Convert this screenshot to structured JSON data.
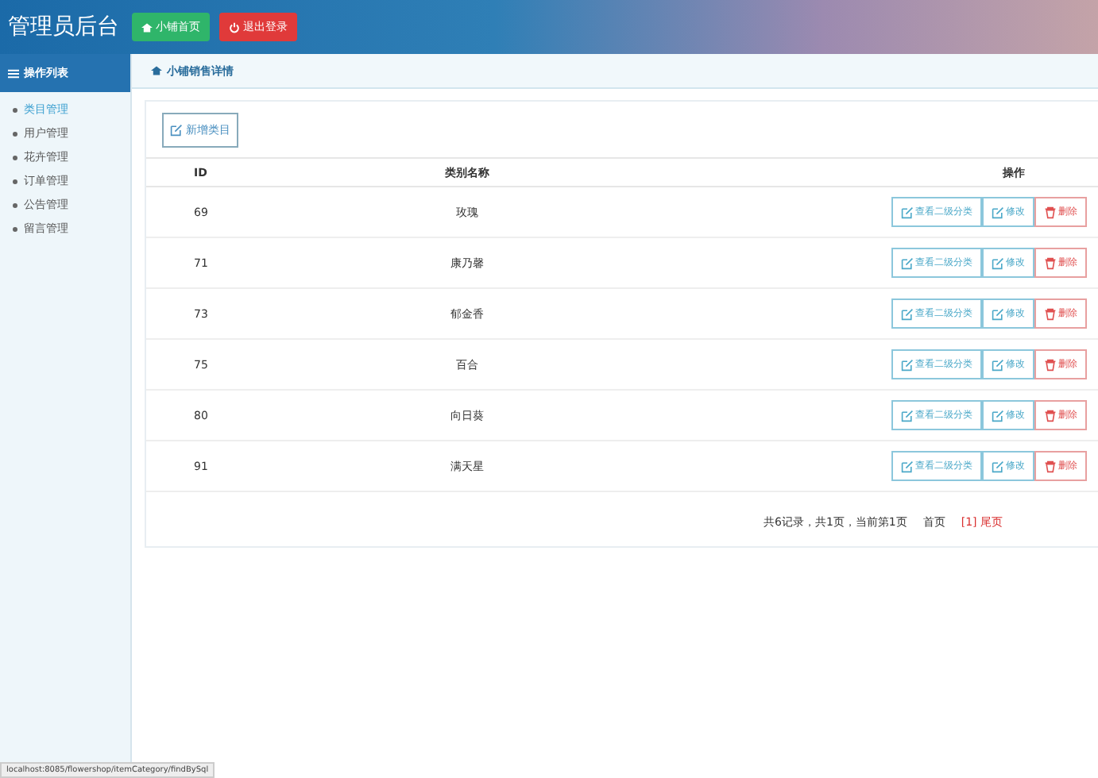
{
  "header": {
    "title": "管理员后台",
    "buttons": [
      {
        "kind": "home",
        "label": "小铺首页"
      },
      {
        "kind": "logout",
        "label": "退出登录"
      }
    ]
  },
  "sidebar": {
    "title": "操作列表",
    "items": [
      {
        "label": "类目管理",
        "selected": true
      },
      {
        "label": "用户管理",
        "selected": false
      },
      {
        "label": "花卉管理",
        "selected": false
      },
      {
        "label": "订单管理",
        "selected": false
      },
      {
        "label": "公告管理",
        "selected": false
      },
      {
        "label": "留言管理",
        "selected": false
      }
    ]
  },
  "breadcrumb": "小铺销售详情",
  "add_button": "新增类目",
  "table": {
    "columns": [
      "ID",
      "类别名称",
      "操作"
    ],
    "rows": [
      {
        "id": "69",
        "name": "玫瑰",
        "actions": [
          {
            "kind": "view",
            "label": "查看二级分类"
          },
          {
            "kind": "edit",
            "label": "修改"
          },
          {
            "kind": "delete",
            "label": "删除"
          }
        ]
      },
      {
        "id": "71",
        "name": "康乃馨",
        "actions": [
          {
            "kind": "view",
            "label": "查看二级分类"
          },
          {
            "kind": "edit",
            "label": "修改"
          },
          {
            "kind": "delete",
            "label": "删除"
          }
        ]
      },
      {
        "id": "73",
        "name": "郁金香",
        "actions": [
          {
            "kind": "view",
            "label": "查看二级分类"
          },
          {
            "kind": "edit",
            "label": "修改"
          },
          {
            "kind": "delete",
            "label": "删除"
          }
        ]
      },
      {
        "id": "75",
        "name": "百合",
        "actions": [
          {
            "kind": "view",
            "label": "查看二级分类"
          },
          {
            "kind": "edit",
            "label": "修改"
          },
          {
            "kind": "delete",
            "label": "删除"
          }
        ]
      },
      {
        "id": "80",
        "name": "向日葵",
        "actions": [
          {
            "kind": "view",
            "label": "查看二级分类"
          },
          {
            "kind": "edit",
            "label": "修改"
          },
          {
            "kind": "delete",
            "label": "删除"
          }
        ]
      },
      {
        "id": "91",
        "name": "满天星",
        "actions": [
          {
            "kind": "view",
            "label": "查看二级分类"
          },
          {
            "kind": "edit",
            "label": "修改"
          },
          {
            "kind": "delete",
            "label": "删除"
          }
        ]
      }
    ]
  },
  "pagination": {
    "summary": "共6记录，共1页，当前第1页",
    "links": [
      {
        "label": "首页",
        "selected": false
      },
      {
        "label": "[1] 尾页",
        "selected": true
      }
    ]
  },
  "status_bar": {
    "url": "localhost:8085/flowershop/itemCategory/findBySql"
  }
}
